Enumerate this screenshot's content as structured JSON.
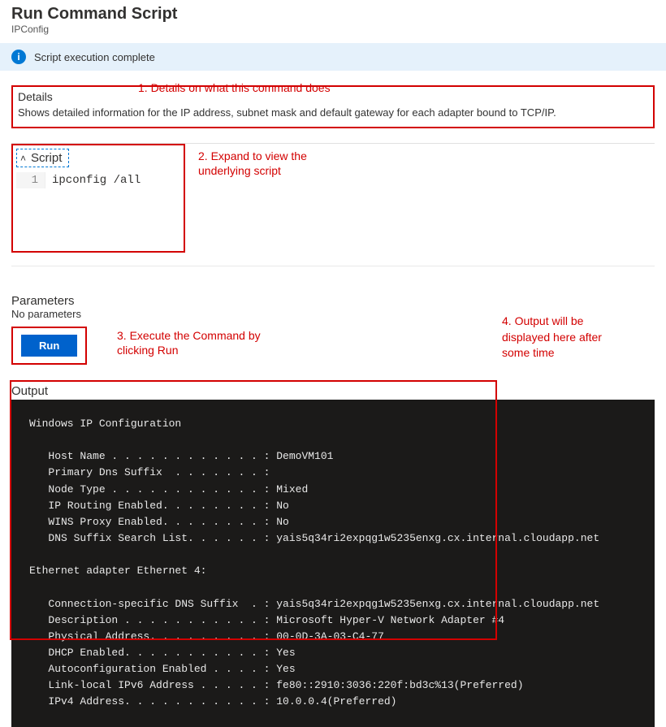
{
  "header": {
    "title": "Run Command Script",
    "subtitle": "IPConfig"
  },
  "status": {
    "icon_label": "i",
    "message": "Script execution complete"
  },
  "annotations": {
    "a1": "1. Details on what this command does",
    "a2_line1": "2. Expand to view the",
    "a2_line2": "underlying script",
    "a3_line1": "3. Execute the Command by",
    "a3_line2": "clicking Run",
    "a4_line1": "4. Output will be",
    "a4_line2": "displayed here after",
    "a4_line3": "some time"
  },
  "details": {
    "label": "Details",
    "text": "Shows detailed information for the IP address, subnet mask and default gateway for each adapter bound to TCP/IP."
  },
  "script": {
    "toggle_label": "Script",
    "line_number": "1",
    "code": "ipconfig /all"
  },
  "parameters": {
    "label": "Parameters",
    "none": "No parameters"
  },
  "run": {
    "label": "Run"
  },
  "output": {
    "label": "Output",
    "text": "Windows IP Configuration\n\n   Host Name . . . . . . . . . . . . : DemoVM101\n   Primary Dns Suffix  . . . . . . . :\n   Node Type . . . . . . . . . . . . : Mixed\n   IP Routing Enabled. . . . . . . . : No\n   WINS Proxy Enabled. . . . . . . . : No\n   DNS Suffix Search List. . . . . . : yais5q34ri2expqg1w5235enxg.cx.internal.cloudapp.net\n\nEthernet adapter Ethernet 4:\n\n   Connection-specific DNS Suffix  . : yais5q34ri2expqg1w5235enxg.cx.internal.cloudapp.net\n   Description . . . . . . . . . . . : Microsoft Hyper-V Network Adapter #4\n   Physical Address. . . . . . . . . : 00-0D-3A-03-C4-77\n   DHCP Enabled. . . . . . . . . . . : Yes\n   Autoconfiguration Enabled . . . . : Yes\n   Link-local IPv6 Address . . . . . : fe80::2910:3036:220f:bd3c%13(Preferred)\n   IPv4 Address. . . . . . . . . . . : 10.0.0.4(Preferred)"
  }
}
